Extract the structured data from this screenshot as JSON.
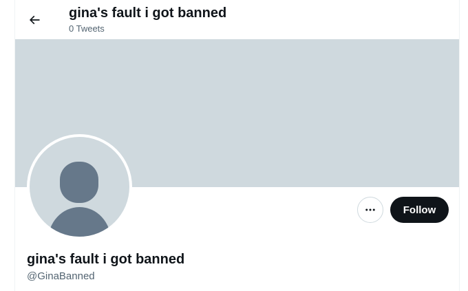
{
  "header": {
    "title": "gina's fault i got banned",
    "subtitle": "0 Tweets",
    "back_icon": "arrow-left-icon"
  },
  "profile": {
    "display_name": "gina's fault i got banned",
    "handle": "@GinaBanned",
    "avatar_icon": "default-avatar-icon"
  },
  "actions": {
    "more_icon": "more-horizontal-icon",
    "follow_label": "Follow"
  },
  "colors": {
    "banner": "#cfd9de",
    "avatar_bg": "#cfd9de",
    "avatar_figure": "#66788a",
    "follow_bg": "#0f1419",
    "text_primary": "#0f1419",
    "text_secondary": "#536471"
  }
}
